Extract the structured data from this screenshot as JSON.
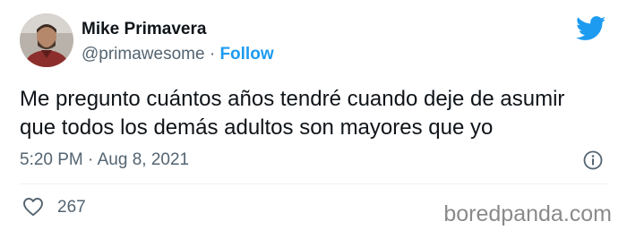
{
  "author": {
    "name": "Mike Primavera",
    "handle": "@primawesome",
    "separator": "·",
    "follow_label": "Follow"
  },
  "tweet": {
    "text_lines": [
      "Me pregunto cuántos años tendré cuando deje de asumir",
      "que todos los demás adultos son mayores que yo"
    ],
    "time": "5:20 PM",
    "date": "Aug 8, 2021",
    "likes": "267"
  },
  "icons": {
    "brand": "twitter-bird-icon",
    "info": "info-icon",
    "like": "heart-icon"
  },
  "watermark": "boredpanda.com",
  "colors": {
    "accent": "#1d9bf0",
    "secondary_text": "#536471",
    "primary_text": "#0f1419"
  }
}
